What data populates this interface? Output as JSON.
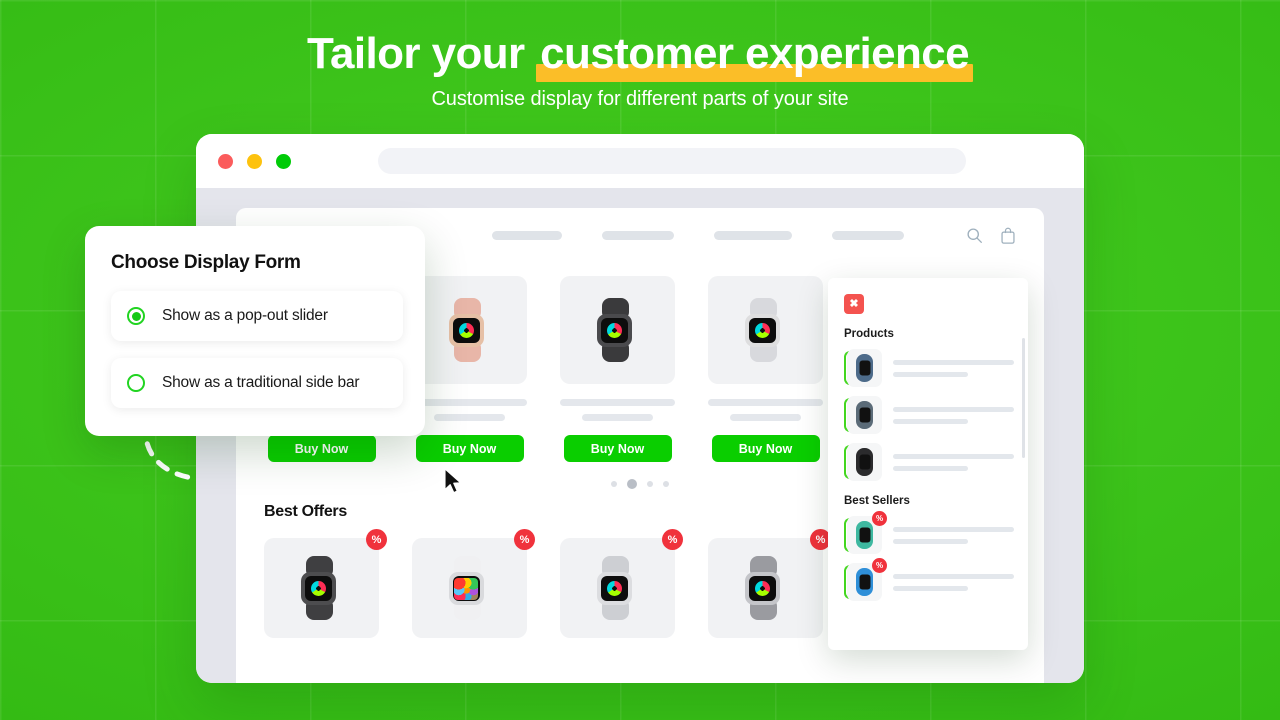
{
  "hero": {
    "title_plain": "Tailor your ",
    "title_highlight": "customer experience",
    "subtitle": "Customise display for different parts of your site",
    "highlight_color": "#fbbe28",
    "background_color": "#3fc71c"
  },
  "browser": {
    "traffic_lights": [
      {
        "name": "close",
        "color": "#fb5c5c"
      },
      {
        "name": "minimize",
        "color": "#fdc20e"
      },
      {
        "name": "maximize",
        "color": "#00cb08"
      }
    ],
    "url_value": "",
    "url_placeholder": ""
  },
  "site": {
    "nav": {
      "links": [
        "",
        "",
        "",
        ""
      ],
      "icons": [
        "search-icon",
        "shopping-bag-icon"
      ]
    },
    "carousel": {
      "buy_label": "Buy Now",
      "products": [
        {
          "name": "watch-space-gray-1",
          "band": "#8e8e93",
          "case": "#c7c8cc",
          "face": "rings"
        },
        {
          "name": "watch-rose-gold",
          "band": "#e8b6a8",
          "case": "#e6c0a6",
          "face": "rings"
        },
        {
          "name": "watch-black",
          "band": "#3a3a3c",
          "case": "#4a4a4d",
          "face": "rings"
        },
        {
          "name": "watch-silver",
          "band": "#d8d9dd",
          "case": "#dededf",
          "face": "rings"
        }
      ],
      "dots": 4,
      "active_dot": 2
    },
    "best_offers": {
      "title": "Best Offers",
      "badge_label": "%",
      "badge_color": "#f0323c",
      "products": [
        {
          "name": "offer-watch-black",
          "band": "#3f3f41",
          "case": "#4d4d4f",
          "face": "rings"
        },
        {
          "name": "offer-watch-white",
          "band": "#f0f0f2",
          "case": "#d9dadd",
          "face": "apps"
        },
        {
          "name": "offer-watch-silver",
          "band": "#cdcfd3",
          "case": "#dcdde0",
          "face": "rings"
        },
        {
          "name": "offer-watch-gray",
          "band": "#9a9ba0",
          "case": "#c4c5c9",
          "face": "rings"
        }
      ]
    }
  },
  "side_panel": {
    "close_label": "✖",
    "sections": [
      {
        "title": "Products",
        "items": [
          {
            "name": "tracker-navy",
            "color": "#4d6b8a",
            "badge": null
          },
          {
            "name": "tracker-slate",
            "color": "#5b6b78",
            "badge": null
          },
          {
            "name": "tracker-black",
            "color": "#2b2b2d",
            "badge": null
          }
        ]
      },
      {
        "title": "Best Sellers",
        "items": [
          {
            "name": "tracker-teal",
            "color": "#3eb8a0",
            "badge": "%"
          },
          {
            "name": "tracker-blue",
            "color": "#2f8fd8",
            "badge": "%"
          }
        ]
      }
    ]
  },
  "display_form": {
    "title": "Choose Display Form",
    "options": [
      {
        "label": "Show as a pop-out slider",
        "selected": true
      },
      {
        "label": "Show as a traditional side bar",
        "selected": false
      }
    ],
    "accent_color": "#21d421"
  }
}
